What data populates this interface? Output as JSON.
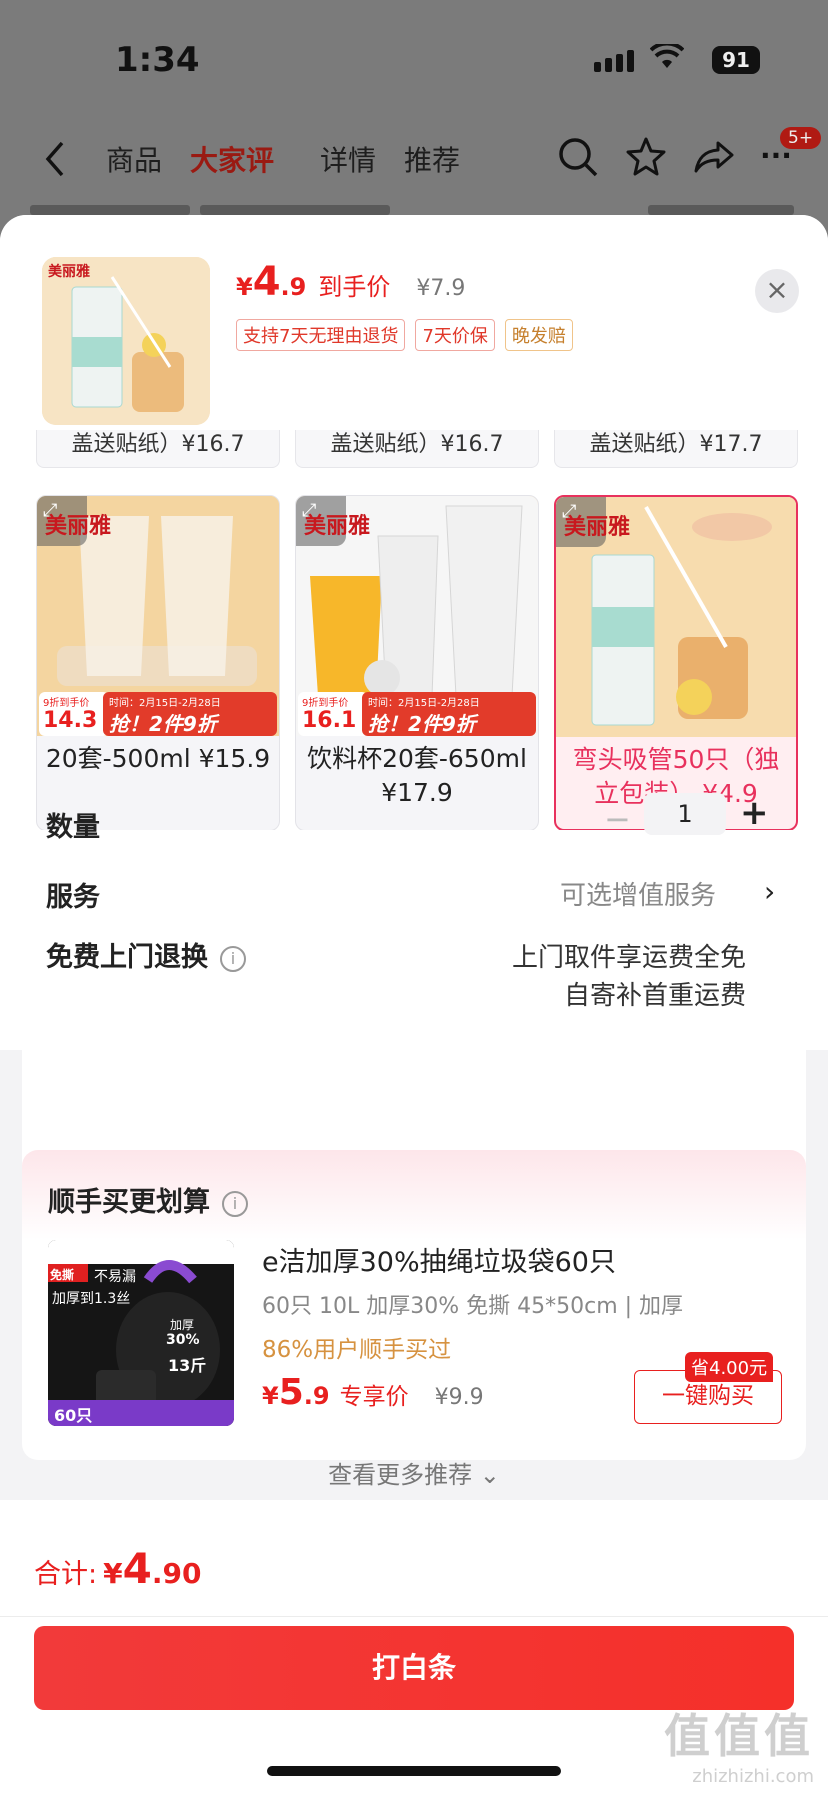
{
  "status": {
    "time": "1:34",
    "battery": "91"
  },
  "nav": {
    "tabs": [
      "商品",
      "大家评",
      "详情",
      "推荐"
    ],
    "badge": "5+"
  },
  "sheet": {
    "header": {
      "currency": "¥",
      "price_int": "4",
      "price_dec": ".9",
      "price_label": "到手价",
      "original_price": "¥7.9",
      "tags": [
        "支持7天无理由退货",
        "7天价保",
        "晚发赔"
      ],
      "close": "×"
    },
    "partial_rows": [
      "盖送贴纸）¥16.7",
      "盖送贴纸）¥16.7",
      "盖送贴纸）¥17.7"
    ],
    "variants": [
      {
        "brand": "美丽雅",
        "promo_small": "9折到手价",
        "promo_price": "14.3",
        "promo_date": "时间：2月15日-2月28日",
        "promo_text": "抢！2件9折",
        "label": "20套-500ml ¥15.9"
      },
      {
        "brand": "美丽雅",
        "promo_small": "9折到手价",
        "promo_price": "16.1",
        "promo_date": "时间：2月15日-2月28日",
        "promo_text": "抢！2件9折",
        "label": "饮料杯20套-650ml ¥17.9"
      },
      {
        "brand": "美丽雅",
        "label": "弯头吸管50只（独立包装） ¥4.9"
      }
    ],
    "quantity": {
      "label": "数量",
      "value": "1",
      "minus": "−",
      "plus": "+"
    },
    "service": {
      "label": "服务",
      "value": "可选增值服务"
    },
    "return": {
      "label": "免费上门退换",
      "line1": "上门取件享运费全免",
      "line2": "自寄补首重运费"
    },
    "recommend": {
      "title": "顺手买更划算",
      "product_name": "e洁加厚30%抽绳垃圾袋60只",
      "spec": "60只 10L 加厚30% 免撕 45*50cm | 加厚",
      "bought": "86%用户顺手买过",
      "currency": "¥",
      "price_int": "5",
      "price_dec": ".9",
      "price_label": "专享价",
      "original_price": "¥9.9",
      "save": "省4.00元",
      "buy": "一键购买",
      "img_texts": [
        "免撕",
        "不易漏",
        "加厚到1.3丝",
        "加厚",
        "30%",
        "13斤",
        "60只"
      ]
    },
    "more": "查看更多推荐 ⌄"
  },
  "footer": {
    "total_label": "合计:",
    "currency": "¥",
    "total_int": "4",
    "total_dec": ".90",
    "pay_button": "打白条"
  },
  "watermark": {
    "main": "值值值",
    "sub": "zhizhizhi.com"
  }
}
